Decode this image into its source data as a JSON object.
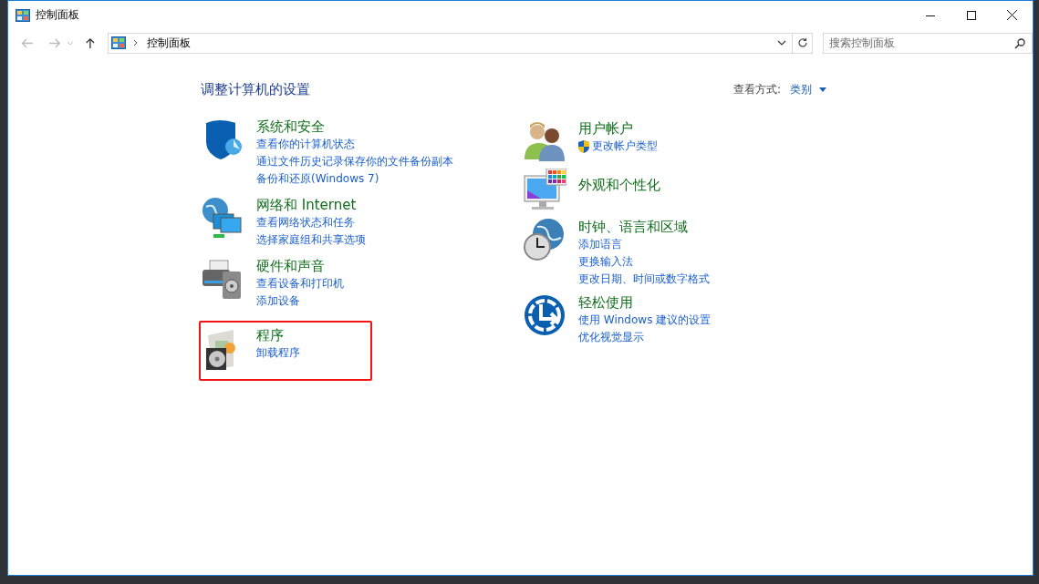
{
  "window": {
    "title": "控制面板"
  },
  "address_bar": {
    "path": "控制面板"
  },
  "search": {
    "placeholder": "搜索控制面板"
  },
  "heading": "调整计算机的设置",
  "view_by": {
    "label": "查看方式:",
    "value": "类别"
  },
  "columns": [
    {
      "categories": [
        {
          "kind": "security",
          "title": "系统和安全",
          "highlighted": false,
          "links": [
            {
              "text": "查看你的计算机状态"
            },
            {
              "text": "通过文件历史记录保存你的文件备份副本"
            },
            {
              "text": "备份和还原(Windows 7)"
            }
          ]
        },
        {
          "kind": "network",
          "title": "网络和 Internet",
          "highlighted": false,
          "links": [
            {
              "text": "查看网络状态和任务"
            },
            {
              "text": "选择家庭组和共享选项"
            }
          ]
        },
        {
          "kind": "hardware",
          "title": "硬件和声音",
          "highlighted": false,
          "links": [
            {
              "text": "查看设备和打印机"
            },
            {
              "text": "添加设备"
            }
          ]
        },
        {
          "kind": "programs",
          "title": "程序",
          "highlighted": true,
          "links": [
            {
              "text": "卸载程序"
            }
          ]
        }
      ]
    },
    {
      "categories": [
        {
          "kind": "users",
          "title": "用户帐户",
          "highlighted": false,
          "links": [
            {
              "text": "更改帐户类型",
              "shield": true
            }
          ]
        },
        {
          "kind": "appearance",
          "title": "外观和个性化",
          "highlighted": false
        },
        {
          "kind": "clock",
          "title": "时钟、语言和区域",
          "highlighted": false,
          "links": [
            {
              "text": "添加语言"
            },
            {
              "text": "更换输入法"
            },
            {
              "text": "更改日期、时间或数字格式"
            }
          ]
        },
        {
          "kind": "ease",
          "title": "轻松使用",
          "highlighted": false,
          "links": [
            {
              "text": "使用 Windows 建议的设置"
            },
            {
              "text": "优化视觉显示"
            }
          ]
        }
      ]
    }
  ]
}
